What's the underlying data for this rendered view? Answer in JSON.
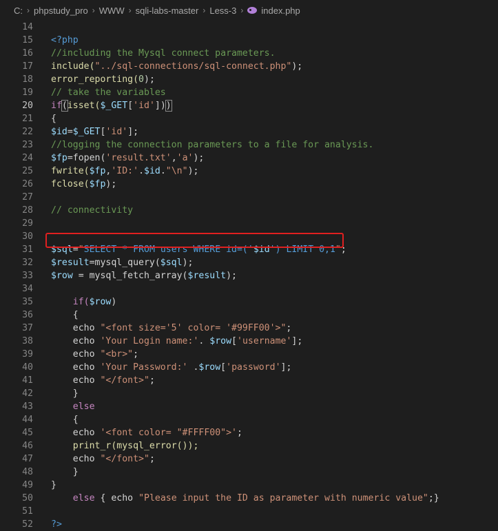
{
  "breadcrumb": [
    "C:",
    "phpstudy_pro",
    "WWW",
    "sqli-labs-master",
    "Less-3",
    "index.php"
  ],
  "icons": {
    "separator": "chevron-right-icon",
    "file": "php-file-icon"
  },
  "highlight_color": "#e02020",
  "active_line": 20,
  "line_numbers": [
    14,
    15,
    16,
    17,
    18,
    19,
    20,
    21,
    22,
    23,
    24,
    25,
    26,
    27,
    28,
    29,
    30,
    31,
    32,
    33,
    34,
    35,
    36,
    37,
    38,
    39,
    40,
    41,
    42,
    43,
    44,
    45,
    46,
    47,
    48,
    49,
    50,
    51,
    52
  ],
  "code": {
    "l15": "<?php",
    "l16": "//including the Mysql connect parameters.",
    "l17_a": "include(",
    "l17_b": "\"../sql-connections/sql-connect.php\"",
    "l17_c": ");",
    "l18_a": "error_reporting(",
    "l18_b": "0",
    "l18_c": ");",
    "l19": "// take the variables",
    "l20_a": "if",
    "l20_b": "(",
    "l20_c": "isset(",
    "l20_d": "$_GET",
    "l20_e": "[",
    "l20_f": "'id'",
    "l20_g": "])",
    "l20_h": ")",
    "l21": "{",
    "l22_a": "$id",
    "l22_b": "=",
    "l22_c": "$_GET",
    "l22_d": "[",
    "l22_e": "'id'",
    "l22_f": "];",
    "l23": "//logging the connection parameters to a file for analysis.",
    "l24_a": "$fp",
    "l24_b": "=fopen(",
    "l24_c": "'result.txt'",
    "l24_d": ",",
    "l24_e": "'a'",
    "l24_f": ");",
    "l25_a": "fwrite(",
    "l25_b": "$fp",
    "l25_c": ",",
    "l25_d": "'ID:'",
    "l25_e": ".",
    "l25_f": "$id",
    "l25_g": ".",
    "l25_h": "\"\\n\"",
    "l25_i": ");",
    "l26_a": "fclose(",
    "l26_b": "$fp",
    "l26_c": ");",
    "l28": "// connectivity",
    "l31_a": "$sql",
    "l31_b": "=",
    "l31_c": "\"",
    "l31_d": "SELECT * FROM users WHERE id=('",
    "l31_e": "$id",
    "l31_f": "') LIMIT 0,1",
    "l31_g": "\"",
    "l31_h": ";",
    "l32_a": "$result",
    "l32_b": "=mysql_query(",
    "l32_c": "$sql",
    "l32_d": ");",
    "l33_a": "$row",
    "l33_b": " = mysql_fetch_array(",
    "l33_c": "$result",
    "l33_d": ");",
    "l35_a": "if(",
    "l35_b": "$row",
    "l35_c": ")",
    "l36": "{",
    "l37_a": "echo ",
    "l37_b": "\"<font size='5' color= '#99FF00'>\"",
    "l37_c": ";",
    "l38_a": "echo ",
    "l38_b": "'Your Login name:'",
    "l38_c": ". ",
    "l38_d": "$row",
    "l38_e": "[",
    "l38_f": "'username'",
    "l38_g": "];",
    "l39_a": "echo ",
    "l39_b": "\"<br>\"",
    "l39_c": ";",
    "l40_a": "echo ",
    "l40_b": "'Your Password:'",
    "l40_c": " .",
    "l40_d": "$row",
    "l40_e": "[",
    "l40_f": "'password'",
    "l40_g": "];",
    "l41_a": "echo ",
    "l41_b": "\"</font>\"",
    "l41_c": ";",
    "l42": "}",
    "l43": "else",
    "l44": "{",
    "l45_a": "echo ",
    "l45_b": "'<font color= \"#FFFF00\">'",
    "l45_c": ";",
    "l46_a": "print_r(",
    "l46_b": "mysql_error());",
    "l47_a": "echo ",
    "l47_b": "\"</font>\"",
    "l47_c": ";",
    "l48": "}",
    "l49": "}",
    "l50_a": "else",
    "l50_b": " { ",
    "l50_c": "echo ",
    "l50_d": "\"Please input the ID as parameter with numeric value\"",
    "l50_e": ";}",
    "l52": "?>"
  }
}
